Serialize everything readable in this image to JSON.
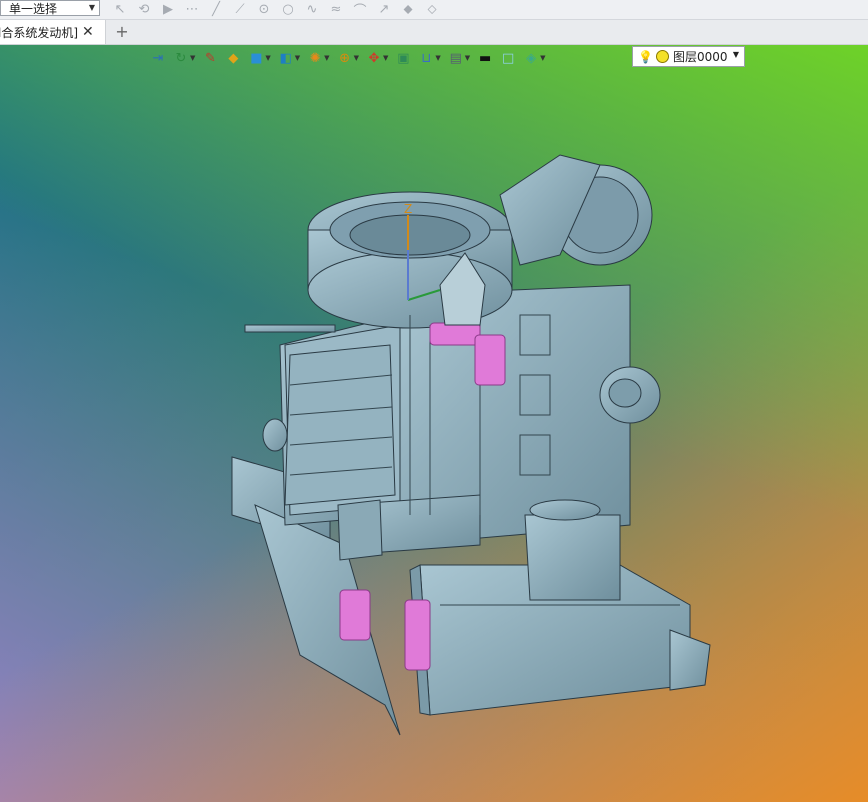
{
  "selection": {
    "mode": "单一选择",
    "tool_icons": [
      "pick-arrow-icon",
      "pick-filter-icon",
      "play-icon",
      "point-icon",
      "line-icon",
      "line2-icon",
      "circle-point-icon",
      "circle-icon",
      "curve-icon",
      "wave-icon",
      "arc-icon",
      "arrow-line-icon",
      "surface-icon",
      "surface2-icon"
    ]
  },
  "tabs": [
    {
      "title": "[组合系统发动机]",
      "visible_title": "l合系统发动机]"
    }
  ],
  "view_toolbar": {
    "tools": [
      {
        "name": "exit-icon",
        "glyph": "⇥",
        "color": "#2c6fb7",
        "dropdown": false
      },
      {
        "name": "coordinate-icon",
        "glyph": "↻",
        "color": "#2b8a3e",
        "dropdown": true
      },
      {
        "name": "sketch-pen-icon",
        "glyph": "✎",
        "color": "#c0392b",
        "dropdown": false
      },
      {
        "name": "solid-face-icon",
        "glyph": "◆",
        "color": "#e0a419",
        "dropdown": false
      },
      {
        "name": "cube-icon",
        "glyph": "■",
        "color": "#2a8fd6",
        "dropdown": true
      },
      {
        "name": "view-orient-icon",
        "glyph": "◧",
        "color": "#1e7fc4",
        "dropdown": true
      },
      {
        "name": "render-style-icon",
        "glyph": "✺",
        "color": "#e8891a",
        "dropdown": true
      },
      {
        "name": "zoom-icon",
        "glyph": "⊕",
        "color": "#d98b0d",
        "dropdown": true
      },
      {
        "name": "pan-icon",
        "glyph": "✥",
        "color": "#d03a2a",
        "dropdown": true
      },
      {
        "name": "fit-view-icon",
        "glyph": "▣",
        "color": "#2e8b57",
        "dropdown": false
      },
      {
        "name": "section-icon",
        "glyph": "⊔",
        "color": "#3a6fc4",
        "dropdown": true
      },
      {
        "name": "display-icon",
        "glyph": "▤",
        "color": "#556070",
        "dropdown": true
      },
      {
        "name": "line-color-icon",
        "glyph": "▬",
        "color": "#111111",
        "dropdown": false
      },
      {
        "name": "fill-color-icon",
        "glyph": "□",
        "color": "#8fd1e8",
        "dropdown": false
      },
      {
        "name": "layer-tool-icon",
        "glyph": "◈",
        "color": "#3aaa8a",
        "dropdown": true
      }
    ]
  },
  "layer": {
    "name": "图层0000"
  },
  "colors": {
    "model_body": "#8fb0be",
    "model_edge": "#2a3a44",
    "highlight": "#e07ad8"
  }
}
